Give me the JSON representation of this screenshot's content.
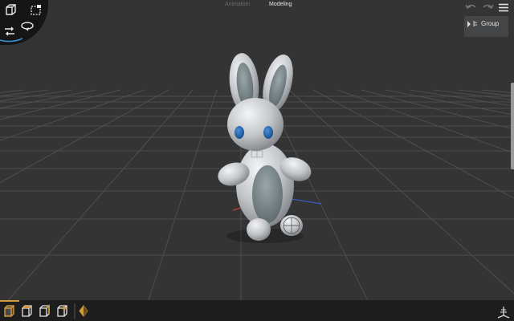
{
  "app": {
    "tabs": [
      {
        "label": "Animation",
        "active": false
      },
      {
        "label": "Modeling",
        "active": true
      }
    ]
  },
  "scene": {
    "outliner_root": "Group",
    "object": "bunny"
  },
  "colors": {
    "background": "#343434",
    "grid": "#5a5a5a",
    "accent": "#d39a3a",
    "eye": "#1f62a8",
    "body": "#c3c6c9"
  },
  "icons": {
    "undo": "undo-icon",
    "redo": "redo-icon",
    "menu": "menu-icon",
    "select": "select-box-icon",
    "cube": "cube-icon",
    "move": "move-icon",
    "rotate": "rotate-icon",
    "keyframe": "keyframe-icon",
    "axes": "axes-icon"
  }
}
